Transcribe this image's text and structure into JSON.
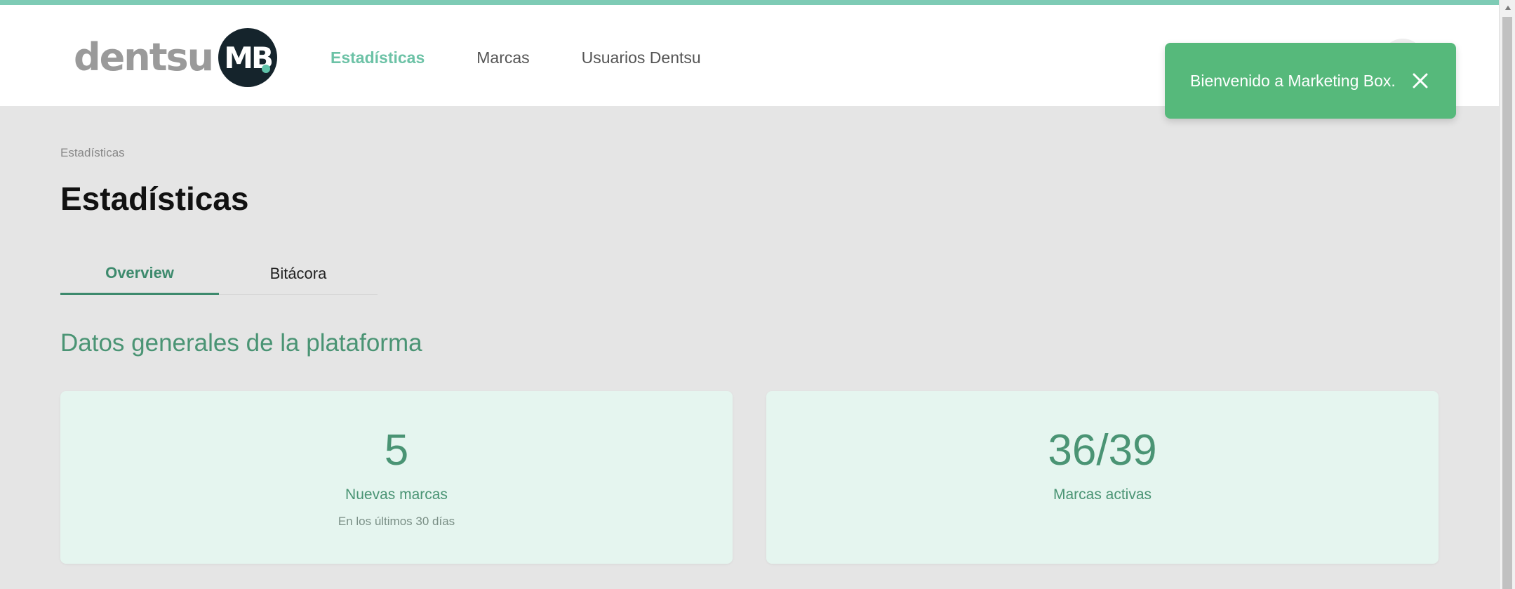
{
  "brand": {
    "logo_text": "dentsu",
    "badge_text": "MB"
  },
  "nav": {
    "items": [
      {
        "label": "Estadísticas",
        "active": true
      },
      {
        "label": "Marcas",
        "active": false
      },
      {
        "label": "Usuarios Dentsu",
        "active": false
      }
    ]
  },
  "toast": {
    "message": "Bienvenido a Marketing Box.",
    "close_icon": "close-icon"
  },
  "breadcrumb": "Estadísticas",
  "page_title": "Estadísticas",
  "tabs": [
    {
      "label": "Overview",
      "active": true
    },
    {
      "label": "Bitácora",
      "active": false
    }
  ],
  "section": {
    "title": "Datos generales de la plataforma"
  },
  "stats": [
    {
      "value": "5",
      "label": "Nuevas marcas",
      "sub": "En los últimos 30 días"
    },
    {
      "value": "36/39",
      "label": "Marcas activas"
    }
  ],
  "colors": {
    "accent_bar": "#7ecbb5",
    "active_nav": "#6cc2a6",
    "primary_green": "#4a9474",
    "toast_bg": "#56b97b",
    "card_bg": "#e5f5ef",
    "page_bg": "#e5e5e5",
    "logo_badge": "#15242c"
  }
}
